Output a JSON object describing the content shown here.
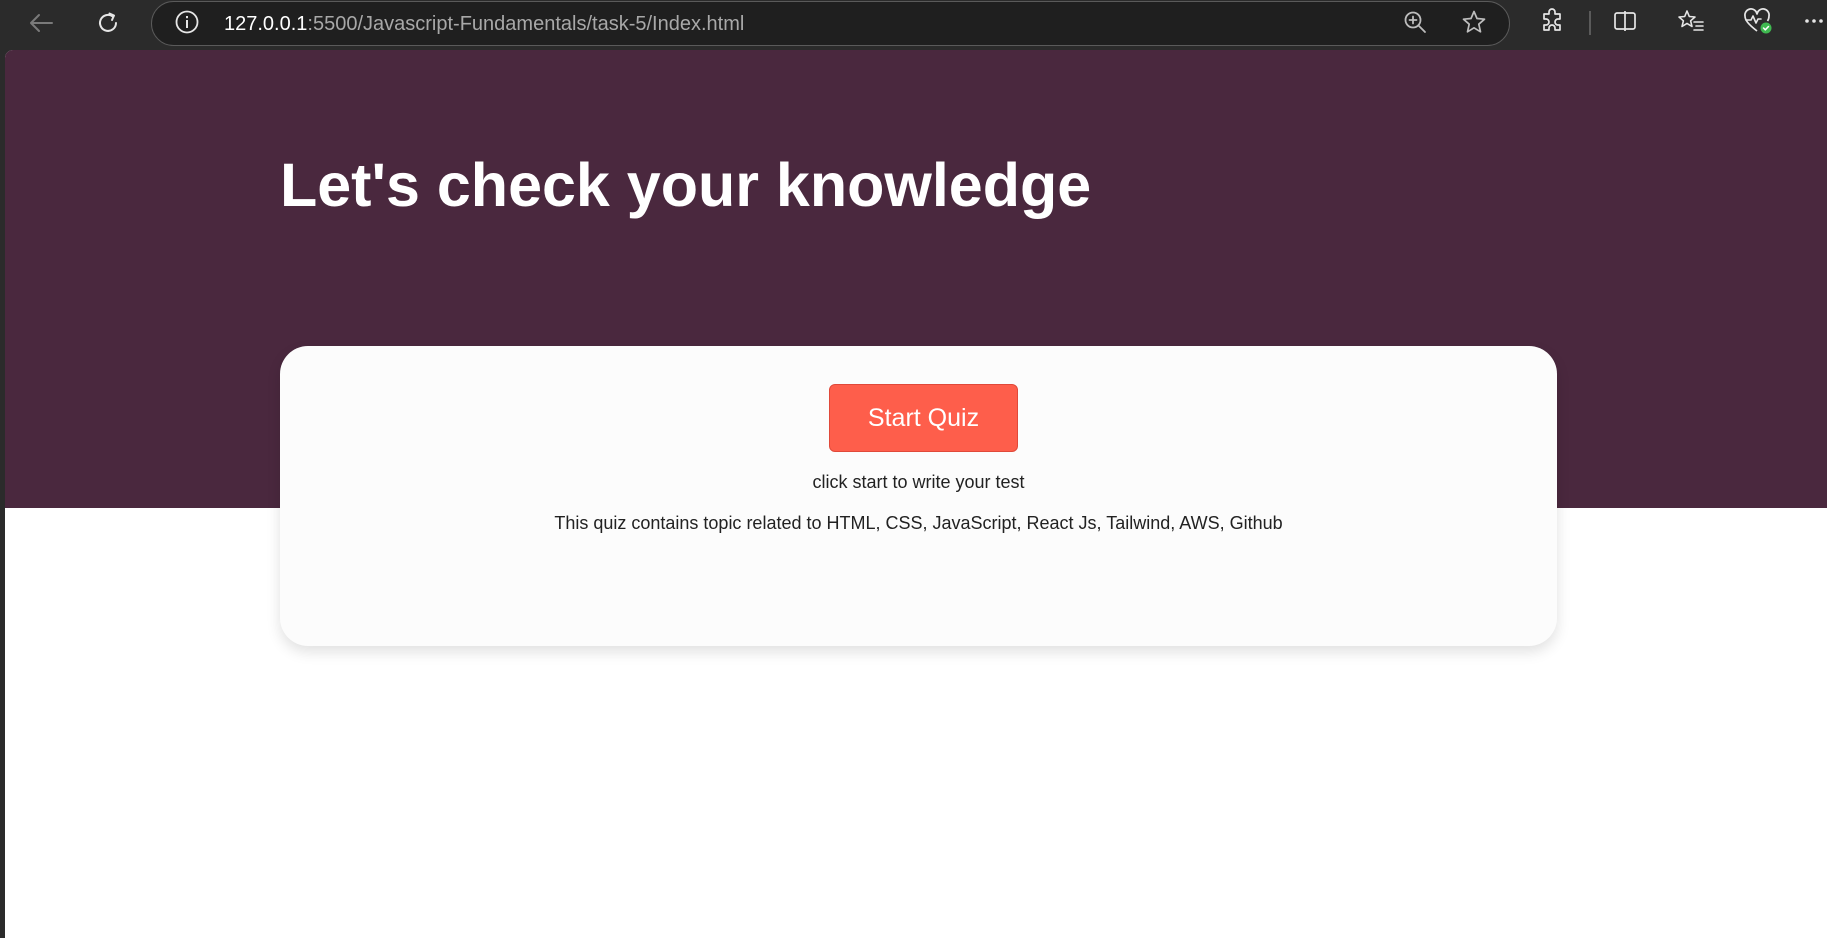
{
  "browser": {
    "url_host": "127.0.0.1",
    "url_rest": ":5500/Javascript-Fundamentals/task-5/Index.html",
    "icons": {
      "back": "back-arrow-icon",
      "refresh": "refresh-icon",
      "site_info": "info-icon",
      "zoom": "zoom-in-icon",
      "favorite": "star-icon",
      "extensions": "puzzle-icon",
      "split_screen": "split-screen-icon",
      "favorites": "favorites-list-icon",
      "browser_essentials": "heart-pulse-icon",
      "more": "more-icon"
    },
    "colors": {
      "toolbar_bg": "#2b2b2b",
      "address_bg": "#1f1f1f",
      "health_badge": "#3fb950"
    }
  },
  "page": {
    "title": "Let's check your knowledge",
    "start_button_label": "Start Quiz",
    "instruction": "click start to write your test",
    "topics": "This quiz contains topic related to HTML, CSS, JavaScript, React Js, Tailwind, AWS, Github",
    "colors": {
      "hero_bg": "#4a283e",
      "button_bg": "#fe5e4b",
      "card_bg": "#fcfcfc"
    }
  }
}
